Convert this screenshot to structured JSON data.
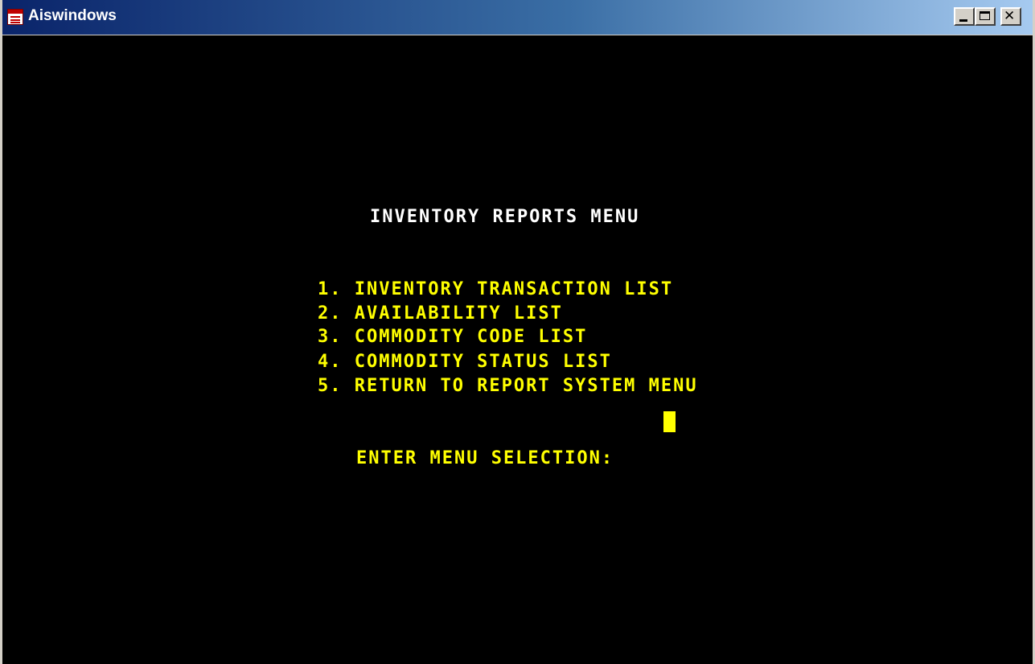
{
  "window": {
    "title": "Aiswindows"
  },
  "screen": {
    "heading": "INVENTORY REPORTS MENU",
    "menu_items": [
      "1. INVENTORY TRANSACTION LIST",
      "2. AVAILABILITY LIST",
      "3. COMMODITY CODE LIST",
      "4. COMMODITY STATUS LIST",
      "5. RETURN TO REPORT SYSTEM MENU"
    ],
    "prompt": "ENTER MENU SELECTION:",
    "input_value": ""
  },
  "colors": {
    "background": "#000000",
    "heading": "#ffffff",
    "text": "#ffff00",
    "titlebar_start": "#0a246a",
    "titlebar_end": "#a6caf0"
  },
  "icons": {
    "app": "window-list-icon",
    "minimize": "minimize-icon",
    "maximize": "maximize-icon",
    "close": "close-icon"
  }
}
